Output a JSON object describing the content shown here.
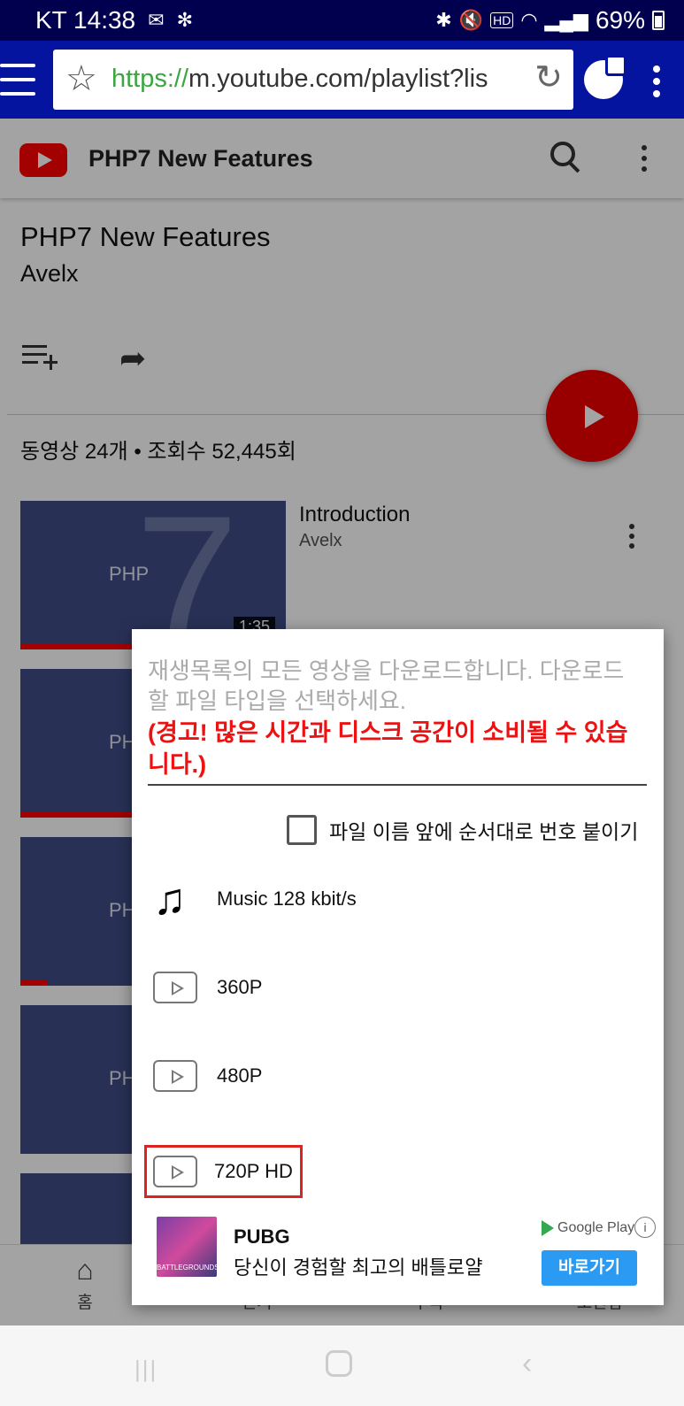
{
  "status_bar": {
    "carrier_time": "KT 14:38",
    "battery": "69%"
  },
  "browser": {
    "url_scheme": "https://",
    "url_rest": "m.youtube.com/playlist?lis"
  },
  "youtube": {
    "header_title": "PHP7 New Features",
    "playlist_title": "PHP7 New Features",
    "playlist_owner": "Avelx",
    "stats": "동영상 24개 • 조회수 52,445회",
    "videos": [
      {
        "title": "Introduction",
        "owner": "Avelx",
        "duration": "1:35",
        "thumb_text": "PHP",
        "progress": 0.45
      },
      {
        "thumb_text": "PHP",
        "progress": 0.42
      },
      {
        "thumb_text": "PHP",
        "progress": 0.1
      },
      {
        "thumb_text": "PHP",
        "progress": 0.0
      }
    ],
    "bottom_nav": [
      {
        "label": "홈",
        "icon": "home-icon"
      },
      {
        "label": "인기",
        "icon": "trending-icon"
      },
      {
        "label": "구독",
        "icon": "subscriptions-icon"
      },
      {
        "label": "보관함",
        "icon": "library-icon"
      }
    ]
  },
  "dialog": {
    "message": "재생목록의 모든 영상을 다운로드합니다. 다운로드 할 파일 타입을 선택하세요.",
    "warning": "(경고! 많은 시간과 디스크 공간이 소비될 수 있습니다.)",
    "checkbox_label": "파일 이름 앞에 순서대로 번호 붙이기",
    "checkbox_checked": false,
    "options": [
      {
        "label": "Music 128 kbit/s",
        "icon": "music-note-icon"
      },
      {
        "label": "360P",
        "icon": "play-icon"
      },
      {
        "label": "480P",
        "icon": "play-icon"
      },
      {
        "label": "720P HD",
        "icon": "play-icon",
        "selected": true
      }
    ]
  },
  "ad": {
    "title": "PUBG",
    "description": "당신이 경험할 최고의 배틀로얄",
    "store": "Google Play",
    "button": "바로가기",
    "image_text": "BATTLEGROUNDS"
  },
  "colors": {
    "status_bar": "#01004e",
    "browser_bar": "#05149f",
    "youtube_red": "#ff0000",
    "warning_red": "#e11111",
    "ad_button": "#2a9af2"
  }
}
